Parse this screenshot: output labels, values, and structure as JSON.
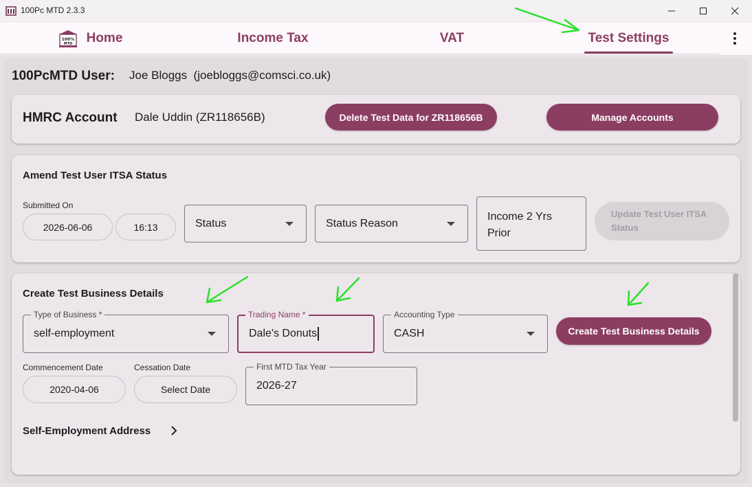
{
  "window": {
    "title": "100Pc MTD 2.3.3",
    "controls": {
      "minimize": "—",
      "maximize": "☐",
      "close": "✕"
    }
  },
  "nav": {
    "logo_text": "100% MTD",
    "tabs": [
      {
        "label": "Home"
      },
      {
        "label": "Income Tax"
      },
      {
        "label": "VAT"
      },
      {
        "label": "Test Settings",
        "active": true
      }
    ],
    "more_icon": "more-vert-icon"
  },
  "user": {
    "label": "100PcMTD User:",
    "value": "Joe Bloggs  (joebloggs@comsci.co.uk)"
  },
  "hmrc": {
    "title": "HMRC Account",
    "account": "Dale Uddin (ZR118656B)",
    "delete_button": "Delete Test Data for ZR118656B",
    "manage_button": "Manage Accounts"
  },
  "itsa": {
    "title": "Amend Test User ITSA Status",
    "submitted_on_label": "Submitted On",
    "date": "2026-06-06",
    "time": "16:13",
    "status_placeholder": "Status",
    "status_reason_placeholder": "Status Reason",
    "income_line1": "Income 2 Yrs",
    "income_line2": "Prior",
    "update_line1": "Update Test User ITSA",
    "update_line2": "Status"
  },
  "business": {
    "title": "Create Test Business Details",
    "type_label": "Type of Business *",
    "type_value": "self-employment",
    "trading_label": "Trading Name *",
    "trading_value": "Dale's Donuts",
    "accounting_label": "Accounting Type",
    "accounting_value": "CASH",
    "create_button": "Create Test Business Details",
    "commencement_label": "Commencement Date",
    "commencement_value": "2020-04-06",
    "cessation_label": "Cessation Date",
    "cessation_value": "Select Date",
    "first_mtd_label": "First MTD Tax Year",
    "first_mtd_value": "2026-27",
    "address_label": "Self-Employment Address"
  },
  "colors": {
    "accent": "#8c3d62",
    "annotation_arrow": "#2be02b"
  }
}
